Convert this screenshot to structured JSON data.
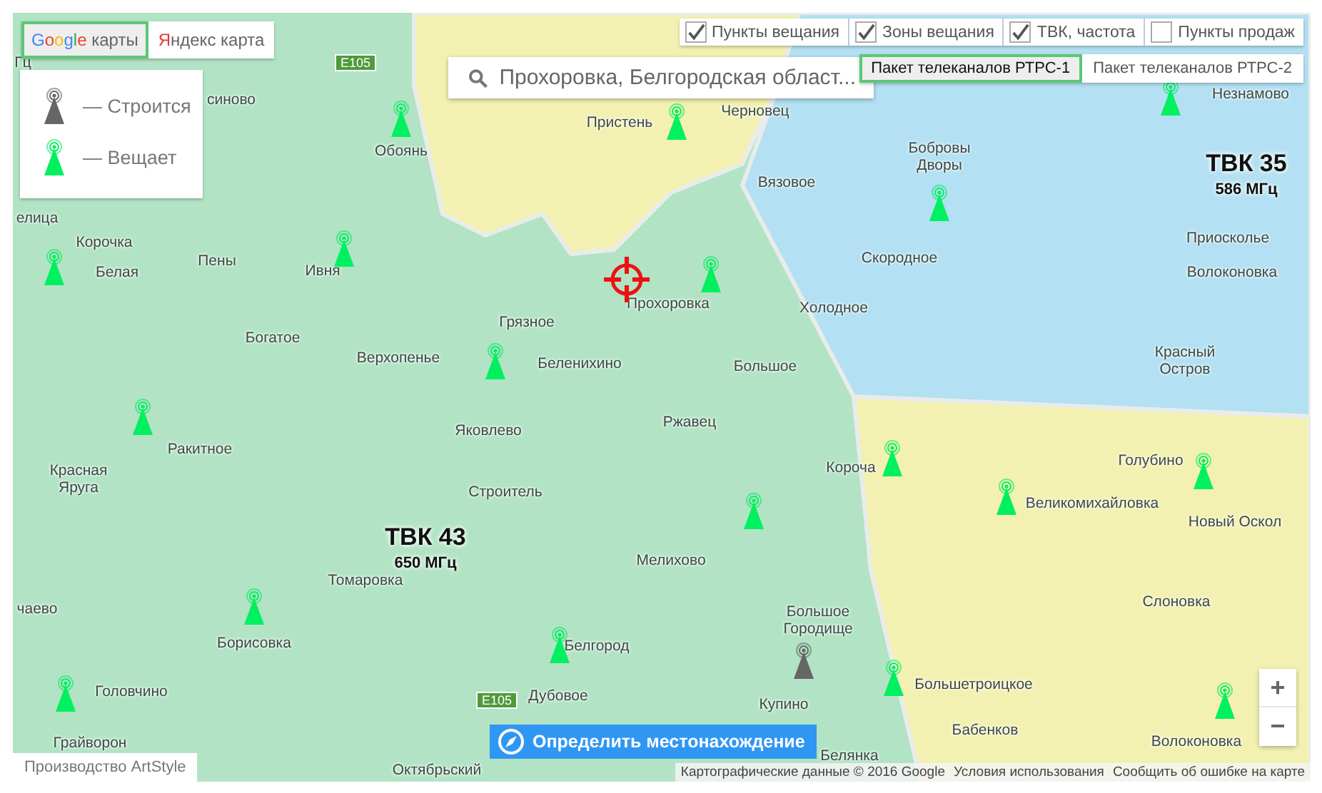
{
  "map_type_tabs": [
    {
      "kind": "google",
      "label": "Google карты",
      "selected": true
    },
    {
      "kind": "yandex",
      "label": "Яндекс карта",
      "selected": false
    }
  ],
  "legend": [
    {
      "kind": "construction",
      "label": "— Строится"
    },
    {
      "kind": "broadcasting",
      "label": "— Вещает"
    }
  ],
  "search": {
    "value": "Прохоровка, Белгородская област..."
  },
  "layer_toggles": [
    {
      "label": "Пункты вещания",
      "checked": true
    },
    {
      "label": "Зоны вещания",
      "checked": true
    },
    {
      "label": "ТВК, частота",
      "checked": true
    },
    {
      "label": "Пункты продаж",
      "checked": false
    }
  ],
  "package_tabs": [
    {
      "label": "Пакет телеканалов РТРС-1",
      "selected": true
    },
    {
      "label": "Пакет телеканалов РТРС-2",
      "selected": false
    }
  ],
  "zones": [
    {
      "color": "#f3f1b2"
    },
    {
      "color": "#b3e0f2",
      "channel": "ТВК 35",
      "frequency": "586 МГц"
    },
    {
      "color": "#f3f1b2"
    },
    {
      "color": "#b2e3c4",
      "channel": "ТВК 43",
      "frequency": "650 МГц"
    }
  ],
  "road_signs": [
    "E105",
    "E105"
  ],
  "places": [
    "Гц",
    "синово",
    "Обоянь",
    "Пристень",
    "Черновец",
    "Незнамово",
    "Бобровы Дворы",
    "Вязовое",
    "елица",
    "Корочка",
    "Белая",
    "Пены",
    "Ивня",
    "Прохоровка",
    "Грязное",
    "Богатое",
    "Верхопенье",
    "Беленихино",
    "Скородное",
    "Холодное",
    "Большое",
    "Приосколье",
    "Волоконовка",
    "Красный Остров",
    "Ржавец",
    "Яковлево",
    "Ракитное",
    "Красная Яруга",
    "Строитель",
    "Короча",
    "Голубино",
    "Великомихайловка",
    "Новый Оскол",
    "Мелихово",
    "чаево",
    "Томаровка",
    "Борисовка",
    "Белгород",
    "Дубовое",
    "Головчино",
    "Грайворон",
    "Октябрьский",
    "Большое Городище",
    "Купино",
    "Большетроицкое",
    "Бабенков",
    "Белянка",
    "Слоновка",
    "Волоконовка"
  ],
  "towers": [
    {
      "kind": "broadcasting"
    },
    {
      "kind": "broadcasting"
    },
    {
      "kind": "broadcasting"
    },
    {
      "kind": "broadcasting"
    },
    {
      "kind": "broadcasting"
    },
    {
      "kind": "broadcasting"
    },
    {
      "kind": "broadcasting"
    },
    {
      "kind": "broadcasting"
    },
    {
      "kind": "broadcasting"
    },
    {
      "kind": "broadcasting"
    },
    {
      "kind": "broadcasting"
    },
    {
      "kind": "broadcasting"
    },
    {
      "kind": "broadcasting"
    },
    {
      "kind": "broadcasting"
    },
    {
      "kind": "broadcasting"
    },
    {
      "kind": "construction"
    },
    {
      "kind": "broadcasting"
    },
    {
      "kind": "broadcasting"
    },
    {
      "kind": "broadcasting"
    }
  ],
  "locate_button": "Определить местонахождение",
  "zoom": {
    "in": "+",
    "out": "−"
  },
  "credit": "Производство ArtStyle",
  "attribution": [
    "Картографические данные © 2016 Google",
    "Условия использования",
    "Сообщить об ошибке на карте"
  ]
}
